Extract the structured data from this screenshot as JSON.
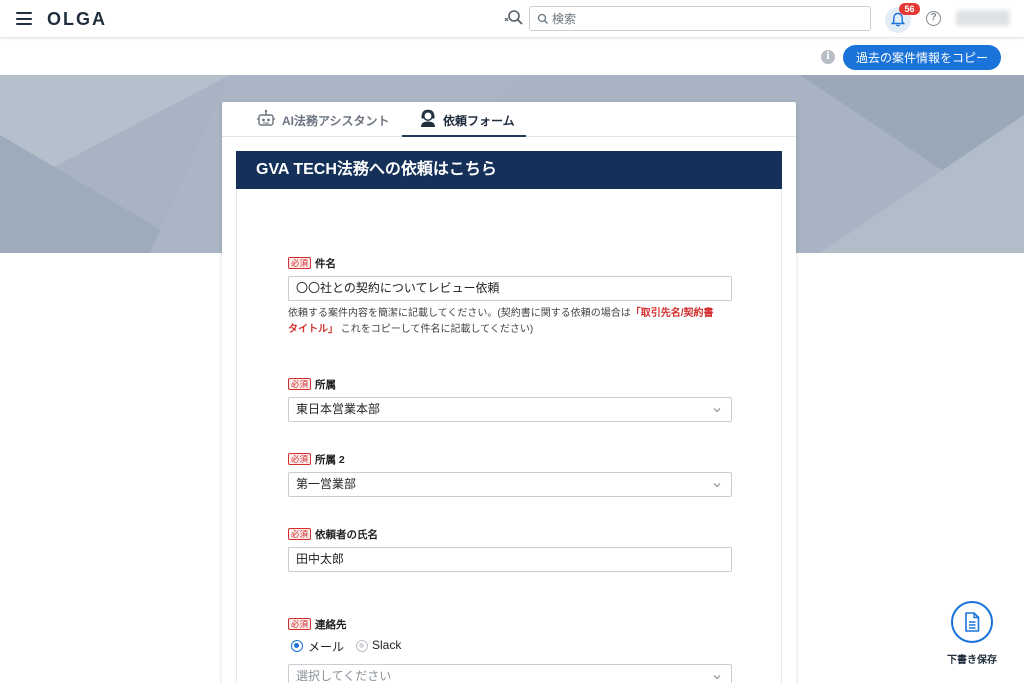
{
  "header": {
    "logo": "OLGA",
    "search_placeholder": "検索",
    "notification_count": "56",
    "help_symbol": "?"
  },
  "copy_bar": {
    "info_symbol": "i",
    "copy_button": "過去の案件情報をコピー"
  },
  "tabs": [
    {
      "label": "AI法務アシスタント",
      "active": false,
      "icon": "robot-icon"
    },
    {
      "label": "依頼フォーム",
      "active": true,
      "icon": "person-headset-icon"
    }
  ],
  "form": {
    "title": "GVA TECH法務への依頼はこちら",
    "required_badge": "必須",
    "fields": {
      "subject": {
        "label": "件名",
        "value": "〇〇社との契約についてレビュー依頼",
        "help_before": "依頼する案件内容を簡潔に記載してください。(契約書に関する依頼の場合は",
        "help_highlight_1": "「取引先名/契約書",
        "help_highlight_2": "タイトル」",
        "help_after": " これをコピーして件名に記載してください)"
      },
      "department": {
        "label": "所属",
        "value": "東日本営業本部"
      },
      "department2": {
        "label": "所属 2",
        "value": "第一営業部"
      },
      "requester": {
        "label": "依頼者の氏名",
        "value": "田中太郎"
      },
      "contact": {
        "label": "連絡先",
        "options": [
          "メール",
          "Slack"
        ],
        "selected": "メール",
        "select_placeholder": "選択してください"
      }
    }
  },
  "draft_save": {
    "label": "下書き保存"
  },
  "colors": {
    "primary": "#1a73d9",
    "header_navy": "#15315a",
    "hero": "#a8b4c3",
    "required_red": "#d32f2f"
  }
}
